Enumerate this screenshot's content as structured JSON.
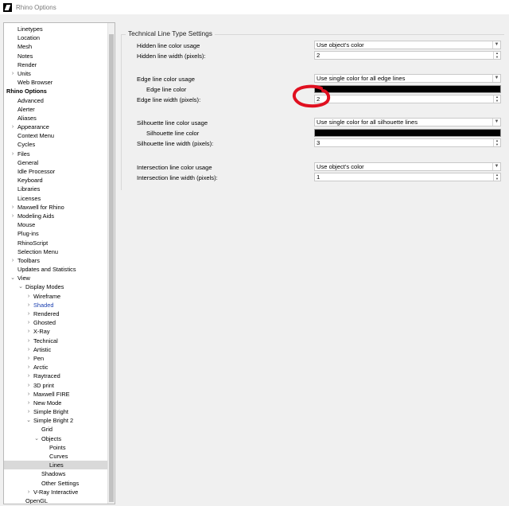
{
  "window": {
    "title": "Rhino Options"
  },
  "tree": {
    "items": [
      {
        "label": "Linetypes",
        "level": 1,
        "arrow": ""
      },
      {
        "label": "Location",
        "level": 1,
        "arrow": ""
      },
      {
        "label": "Mesh",
        "level": 1,
        "arrow": ""
      },
      {
        "label": "Notes",
        "level": 1,
        "arrow": ""
      },
      {
        "label": "Render",
        "level": 1,
        "arrow": ""
      },
      {
        "label": "Units",
        "level": 1,
        "arrow": "›"
      },
      {
        "label": "Web Browser",
        "level": 1,
        "arrow": ""
      },
      {
        "label": "Rhino Options",
        "level": 0,
        "arrow": "",
        "bold": true
      },
      {
        "label": "Advanced",
        "level": 1,
        "arrow": ""
      },
      {
        "label": "Alerter",
        "level": 1,
        "arrow": ""
      },
      {
        "label": "Aliases",
        "level": 1,
        "arrow": ""
      },
      {
        "label": "Appearance",
        "level": 1,
        "arrow": "›"
      },
      {
        "label": "Context Menu",
        "level": 1,
        "arrow": ""
      },
      {
        "label": "Cycles",
        "level": 1,
        "arrow": ""
      },
      {
        "label": "Files",
        "level": 1,
        "arrow": "›"
      },
      {
        "label": "General",
        "level": 1,
        "arrow": ""
      },
      {
        "label": "Idle Processor",
        "level": 1,
        "arrow": ""
      },
      {
        "label": "Keyboard",
        "level": 1,
        "arrow": ""
      },
      {
        "label": "Libraries",
        "level": 1,
        "arrow": ""
      },
      {
        "label": "Licenses",
        "level": 1,
        "arrow": ""
      },
      {
        "label": "Maxwell for Rhino",
        "level": 1,
        "arrow": "›"
      },
      {
        "label": "Modeling Aids",
        "level": 1,
        "arrow": "›"
      },
      {
        "label": "Mouse",
        "level": 1,
        "arrow": ""
      },
      {
        "label": "Plug-ins",
        "level": 1,
        "arrow": ""
      },
      {
        "label": "RhinoScript",
        "level": 1,
        "arrow": ""
      },
      {
        "label": "Selection Menu",
        "level": 1,
        "arrow": ""
      },
      {
        "label": "Toolbars",
        "level": 1,
        "arrow": "›"
      },
      {
        "label": "Updates and Statistics",
        "level": 1,
        "arrow": ""
      },
      {
        "label": "View",
        "level": 1,
        "arrow": "⌄"
      },
      {
        "label": "Display Modes",
        "level": 2,
        "arrow": "⌄"
      },
      {
        "label": "Wireframe",
        "level": 3,
        "arrow": "›"
      },
      {
        "label": "Shaded",
        "level": 3,
        "arrow": "›",
        "active": true
      },
      {
        "label": "Rendered",
        "level": 3,
        "arrow": "›"
      },
      {
        "label": "Ghosted",
        "level": 3,
        "arrow": "›"
      },
      {
        "label": "X-Ray",
        "level": 3,
        "arrow": "›"
      },
      {
        "label": "Technical",
        "level": 3,
        "arrow": "›"
      },
      {
        "label": "Artistic",
        "level": 3,
        "arrow": "›"
      },
      {
        "label": "Pen",
        "level": 3,
        "arrow": "›"
      },
      {
        "label": "Arctic",
        "level": 3,
        "arrow": "›"
      },
      {
        "label": "Raytraced",
        "level": 3,
        "arrow": "›"
      },
      {
        "label": "3D print",
        "level": 3,
        "arrow": "›"
      },
      {
        "label": "Maxwell FIRE",
        "level": 3,
        "arrow": "›"
      },
      {
        "label": "New Mode",
        "level": 3,
        "arrow": "›"
      },
      {
        "label": "Simple Bright",
        "level": 3,
        "arrow": "›"
      },
      {
        "label": "Simple Bright 2",
        "level": 3,
        "arrow": "⌄"
      },
      {
        "label": "Grid",
        "level": 4,
        "arrow": ""
      },
      {
        "label": "Objects",
        "level": 4,
        "arrow": "⌄"
      },
      {
        "label": "Points",
        "level": 5,
        "arrow": ""
      },
      {
        "label": "Curves",
        "level": 5,
        "arrow": ""
      },
      {
        "label": "Lines",
        "level": 5,
        "arrow": "",
        "selected": true
      },
      {
        "label": "Shadows",
        "level": 4,
        "arrow": ""
      },
      {
        "label": "Other Settings",
        "level": 4,
        "arrow": ""
      },
      {
        "label": "V-Ray Interactive",
        "level": 3,
        "arrow": "›"
      },
      {
        "label": "OpenGL",
        "level": 2,
        "arrow": ""
      }
    ]
  },
  "settings": {
    "group_title": "Technical Line Type Settings",
    "hidden_color_label": "Hidden line color usage",
    "hidden_color_value": "Use object's color",
    "hidden_width_label": "Hidden line width (pixels):",
    "hidden_width_value": "2",
    "edge_color_label": "Edge line color usage",
    "edge_color_value": "Use single color for all edge lines",
    "edge_swatch_label": "Edge line color",
    "edge_swatch_color": "#000000",
    "edge_width_label": "Edge line width (pixels):",
    "edge_width_value": "2",
    "silhouette_color_label": "Silhouette line color usage",
    "silhouette_color_value": "Use single color for all silhouette lines",
    "silhouette_swatch_label": "Silhouette line color",
    "silhouette_swatch_color": "#000000",
    "silhouette_width_label": "Silhouette line width (pixels):",
    "silhouette_width_value": "3",
    "intersection_color_label": "Intersection line color usage",
    "intersection_color_value": "Use object's color",
    "intersection_width_label": "Intersection line width (pixels):",
    "intersection_width_value": "1"
  },
  "icons": {
    "dropdown": "chevron-down-icon",
    "spinner": "spinner-arrows-icon",
    "expand": "chevron-right-icon",
    "collapse": "chevron-down-icon"
  },
  "colors": {
    "annotation": "#e01020",
    "selection": "#d9d9d9",
    "active_item": "#1a3fb0"
  }
}
